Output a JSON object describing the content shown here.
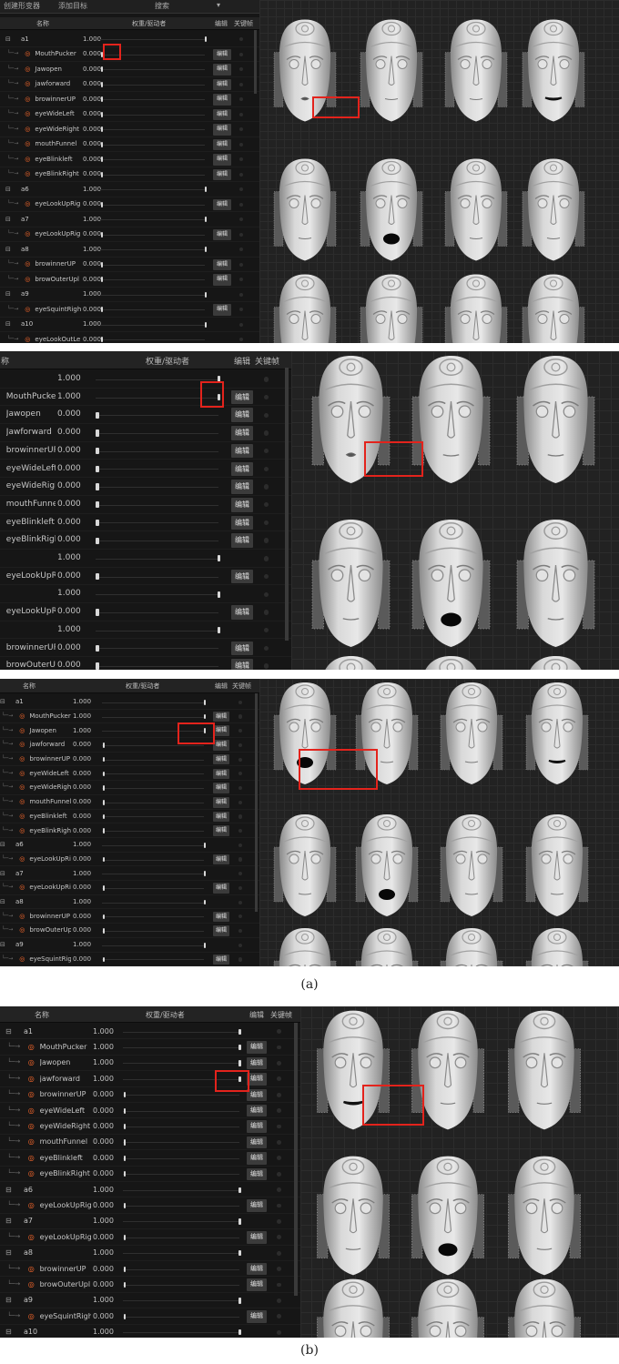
{
  "labels": {
    "col_name": "名称",
    "col_weight": "权重/驱动者",
    "col_edit": "编辑",
    "col_key": "关键帧",
    "edit": "编辑",
    "toolbar_left": "创建形变器",
    "toolbar_mid": "添加目标",
    "toolbar_search": "搜索"
  },
  "captions": {
    "a": "(a)",
    "b": "(b)"
  },
  "panel1": {
    "rows": [
      {
        "n": "a1",
        "v": "1.000",
        "w": 1,
        "g": 1,
        "d": 0
      },
      {
        "n": "MouthPucker",
        "v": "0.000",
        "w": 0,
        "g": 0,
        "d": 1
      },
      {
        "n": "Jawopen",
        "v": "0.000",
        "w": 0,
        "g": 0,
        "d": 1
      },
      {
        "n": "jawforward",
        "v": "0.000",
        "w": 0,
        "g": 0,
        "d": 1
      },
      {
        "n": "browinnerUP",
        "v": "0.000",
        "w": 0,
        "g": 0,
        "d": 1
      },
      {
        "n": "eyeWideLeft",
        "v": "0.000",
        "w": 0,
        "g": 0,
        "d": 1
      },
      {
        "n": "eyeWideRight",
        "v": "0.000",
        "w": 0,
        "g": 0,
        "d": 1
      },
      {
        "n": "mouthFunnel",
        "v": "0.000",
        "w": 0,
        "g": 0,
        "d": 1
      },
      {
        "n": "eyeBlinkleft",
        "v": "0.000",
        "w": 0,
        "g": 0,
        "d": 1
      },
      {
        "n": "eyeBlinkRight",
        "v": "0.000",
        "w": 0,
        "g": 0,
        "d": 1
      },
      {
        "n": "a6",
        "v": "1.000",
        "w": 1,
        "g": 1,
        "d": 0
      },
      {
        "n": "eyeLookUpRig",
        "v": "0.000",
        "w": 0,
        "g": 0,
        "d": 1
      },
      {
        "n": "a7",
        "v": "1.000",
        "w": 1,
        "g": 1,
        "d": 0
      },
      {
        "n": "eyeLookUpRig",
        "v": "0.000",
        "w": 0,
        "g": 0,
        "d": 1
      },
      {
        "n": "a8",
        "v": "1.000",
        "w": 1,
        "g": 1,
        "d": 0
      },
      {
        "n": "browinnerUP",
        "v": "0.000",
        "w": 0,
        "g": 0,
        "d": 1
      },
      {
        "n": "browOuterUpl",
        "v": "0.000",
        "w": 0,
        "g": 0,
        "d": 1
      },
      {
        "n": "a9",
        "v": "1.000",
        "w": 1,
        "g": 1,
        "d": 0
      },
      {
        "n": "eyeSquintRight",
        "v": "0.000",
        "w": 0,
        "g": 0,
        "d": 1
      },
      {
        "n": "a10",
        "v": "1.000",
        "w": 1,
        "g": 1,
        "d": 0
      },
      {
        "n": "eyeLookOutLe",
        "v": "0.000",
        "w": 0,
        "g": 0,
        "d": 0
      }
    ]
  },
  "panel2": {
    "rows": [
      {
        "n": "",
        "v": "1.000",
        "w": 1,
        "g": 1,
        "d": 0
      },
      {
        "n": "MouthPucker",
        "v": "1.000",
        "w": 1,
        "g": 0,
        "d": 1
      },
      {
        "n": "Jawopen",
        "v": "0.000",
        "w": 0,
        "g": 0,
        "d": 1
      },
      {
        "n": "Jawforward",
        "v": "0.000",
        "w": 0,
        "g": 0,
        "d": 1
      },
      {
        "n": "browinnerUP",
        "v": "0.000",
        "w": 0,
        "g": 0,
        "d": 1
      },
      {
        "n": "eyeWideLeft",
        "v": "0.000",
        "w": 0,
        "g": 0,
        "d": 1
      },
      {
        "n": "eyeWideRight",
        "v": "0.000",
        "w": 0,
        "g": 0,
        "d": 1
      },
      {
        "n": "mouthFunnel",
        "v": "0.000",
        "w": 0,
        "g": 0,
        "d": 1
      },
      {
        "n": "eyeBlinkleft",
        "v": "0.000",
        "w": 0,
        "g": 0,
        "d": 1
      },
      {
        "n": "eyeBlinkRight",
        "v": "0.000",
        "w": 0,
        "g": 0,
        "d": 1
      },
      {
        "n": "",
        "v": "1.000",
        "w": 1,
        "g": 1,
        "d": 0
      },
      {
        "n": "eyeLookUpRig",
        "v": "0.000",
        "w": 0,
        "g": 0,
        "d": 1
      },
      {
        "n": "",
        "v": "1.000",
        "w": 1,
        "g": 1,
        "d": 0
      },
      {
        "n": "eyeLookUpRig",
        "v": "0.000",
        "w": 0,
        "g": 0,
        "d": 1
      },
      {
        "n": "",
        "v": "1.000",
        "w": 1,
        "g": 1,
        "d": 0
      },
      {
        "n": "browinnerUP",
        "v": "0.000",
        "w": 0,
        "g": 0,
        "d": 1
      },
      {
        "n": "browOuterUpl",
        "v": "0.000",
        "w": 0,
        "g": 0,
        "d": 1
      }
    ]
  },
  "panel3": {
    "rows": [
      {
        "n": "a1",
        "v": "1.000",
        "w": 1,
        "g": 1,
        "d": 0
      },
      {
        "n": "MouthPucker",
        "v": "1.000",
        "w": 1,
        "g": 0,
        "d": 1
      },
      {
        "n": "Jawopen",
        "v": "1.000",
        "w": 1,
        "g": 0,
        "d": 1
      },
      {
        "n": "jawforward",
        "v": "0.000",
        "w": 0,
        "g": 0,
        "d": 1
      },
      {
        "n": "browinnerUP",
        "v": "0.000",
        "w": 0,
        "g": 0,
        "d": 1
      },
      {
        "n": "eyeWideLeft",
        "v": "0.000",
        "w": 0,
        "g": 0,
        "d": 1
      },
      {
        "n": "eyeWideRight",
        "v": "0.000",
        "w": 0,
        "g": 0,
        "d": 1
      },
      {
        "n": "mouthFunnel",
        "v": "0.000",
        "w": 0,
        "g": 0,
        "d": 1
      },
      {
        "n": "eyeBlinkleft",
        "v": "0.000",
        "w": 0,
        "g": 0,
        "d": 1
      },
      {
        "n": "eyeBlinkRight",
        "v": "0.000",
        "w": 0,
        "g": 0,
        "d": 1
      },
      {
        "n": "a6",
        "v": "1.000",
        "w": 1,
        "g": 1,
        "d": 0
      },
      {
        "n": "eyeLookUpRig",
        "v": "0.000",
        "w": 0,
        "g": 0,
        "d": 1
      },
      {
        "n": "a7",
        "v": "1.000",
        "w": 1,
        "g": 1,
        "d": 0
      },
      {
        "n": "eyeLookUpRig",
        "v": "0.000",
        "w": 0,
        "g": 0,
        "d": 1
      },
      {
        "n": "a8",
        "v": "1.000",
        "w": 1,
        "g": 1,
        "d": 0
      },
      {
        "n": "browinnerUP",
        "v": "0.000",
        "w": 0,
        "g": 0,
        "d": 1
      },
      {
        "n": "browOuterUpl",
        "v": "0.000",
        "w": 0,
        "g": 0,
        "d": 1
      },
      {
        "n": "a9",
        "v": "1.000",
        "w": 1,
        "g": 1,
        "d": 0
      },
      {
        "n": "eyeSquintRight",
        "v": "0.000",
        "w": 0,
        "g": 0,
        "d": 1
      }
    ]
  },
  "panel4": {
    "rows": [
      {
        "n": "a1",
        "v": "1.000",
        "w": 1,
        "g": 1,
        "d": 0
      },
      {
        "n": "MouthPucker",
        "v": "1.000",
        "w": 1,
        "g": 0,
        "d": 1
      },
      {
        "n": "Jawopen",
        "v": "1.000",
        "w": 1,
        "g": 0,
        "d": 1
      },
      {
        "n": "jawforward",
        "v": "1.000",
        "w": 1,
        "g": 0,
        "d": 1
      },
      {
        "n": "browinnerUP",
        "v": "0.000",
        "w": 0,
        "g": 0,
        "d": 1
      },
      {
        "n": "eyeWideLeft",
        "v": "0.000",
        "w": 0,
        "g": 0,
        "d": 1
      },
      {
        "n": "eyeWideRight",
        "v": "0.000",
        "w": 0,
        "g": 0,
        "d": 1
      },
      {
        "n": "mouthFunnel",
        "v": "0.000",
        "w": 0,
        "g": 0,
        "d": 1
      },
      {
        "n": "eyeBlinkleft",
        "v": "0.000",
        "w": 0,
        "g": 0,
        "d": 1
      },
      {
        "n": "eyeBlinkRight",
        "v": "0.000",
        "w": 0,
        "g": 0,
        "d": 1
      },
      {
        "n": "a6",
        "v": "1.000",
        "w": 1,
        "g": 1,
        "d": 0
      },
      {
        "n": "eyeLookUpRig",
        "v": "0.000",
        "w": 0,
        "g": 0,
        "d": 1
      },
      {
        "n": "a7",
        "v": "1.000",
        "w": 1,
        "g": 1,
        "d": 0
      },
      {
        "n": "eyeLookUpRig",
        "v": "0.000",
        "w": 0,
        "g": 0,
        "d": 1
      },
      {
        "n": "a8",
        "v": "1.000",
        "w": 1,
        "g": 1,
        "d": 0
      },
      {
        "n": "browinnerUP",
        "v": "0.000",
        "w": 0,
        "g": 0,
        "d": 1
      },
      {
        "n": "browOuterUpl",
        "v": "0.000",
        "w": 0,
        "g": 0,
        "d": 1
      },
      {
        "n": "a9",
        "v": "1.000",
        "w": 1,
        "g": 1,
        "d": 0
      },
      {
        "n": "eyeSquintRight",
        "v": "0.000",
        "w": 0,
        "g": 0,
        "d": 1
      },
      {
        "n": "a10",
        "v": "1.000",
        "w": 1,
        "g": 1,
        "d": 0
      }
    ]
  },
  "viewports": {
    "p1": {
      "mouths": [
        "pucker",
        "neutral",
        "neutral",
        "forward",
        "neutral",
        "open",
        "neutral",
        "neutral",
        "neutral",
        "neutral",
        "neutral",
        "neutral"
      ]
    },
    "p2": {
      "mouths": [
        "pucker",
        "neutral",
        "neutral",
        "neutral",
        "open",
        "neutral",
        "neutral",
        "neutral",
        "neutral"
      ]
    },
    "p3": {
      "mouths": [
        "open",
        "neutral",
        "neutral",
        "forward",
        "neutral",
        "open",
        "neutral",
        "neutral",
        "neutral",
        "neutral",
        "neutral",
        "neutral"
      ]
    },
    "p4": {
      "mouths": [
        "forward",
        "neutral",
        "neutral",
        "neutral",
        "open",
        "neutral",
        "neutral",
        "neutral",
        "neutral"
      ]
    }
  }
}
